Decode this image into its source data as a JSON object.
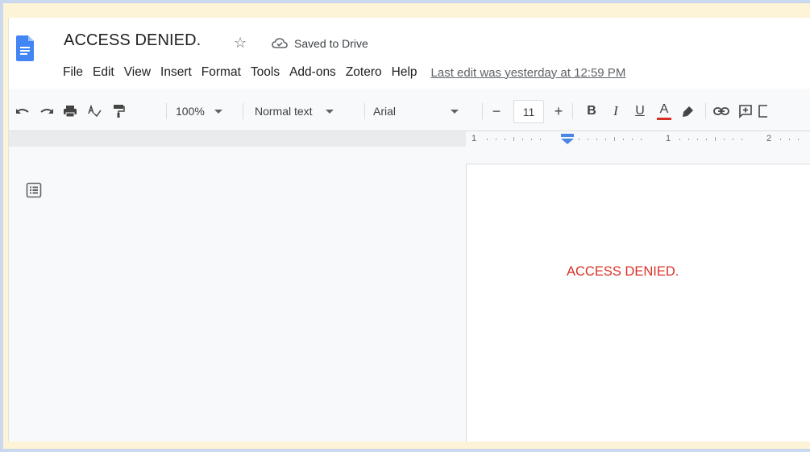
{
  "document": {
    "title": "ACCESS DENIED.",
    "saved_status": "Saved to Drive",
    "body_text": "ACCESS DENIED."
  },
  "menu": {
    "items": [
      "File",
      "Edit",
      "View",
      "Insert",
      "Format",
      "Tools",
      "Add-ons",
      "Zotero",
      "Help"
    ],
    "last_edit": "Last edit was yesterday at 12:59 PM"
  },
  "toolbar": {
    "zoom": "100%",
    "style": "Normal text",
    "font": "Arial",
    "font_size": "11",
    "minus": "−",
    "plus": "+",
    "bold": "B",
    "italic": "I",
    "underline": "U",
    "text_color_letter": "A",
    "text_color": "#d93025"
  },
  "ruler": {
    "marks": [
      "1",
      "1",
      "2"
    ]
  },
  "colors": {
    "docs_blue": "#4285f4",
    "ruler_indent": "#4a86e8",
    "body_text": "#d93025"
  },
  "icons": [
    "doc-icon",
    "star-icon",
    "cloud-check-icon",
    "undo-icon",
    "redo-icon",
    "print-icon",
    "spellcheck-icon",
    "paint-format-icon",
    "highlighter-icon",
    "link-icon",
    "add-comment-icon",
    "outline-icon"
  ]
}
